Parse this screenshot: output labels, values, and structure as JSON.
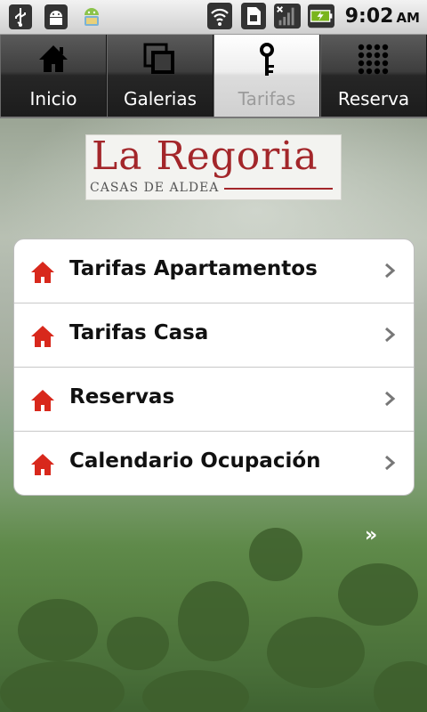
{
  "status_bar": {
    "time": "9:02",
    "ampm": "AM",
    "icons": [
      "usb-icon",
      "android-debug-icon",
      "android-app-icon",
      "wifi-icon",
      "sim-card-icon",
      "signal-icon",
      "battery-charging-icon"
    ]
  },
  "tabs": [
    {
      "label": "Inicio",
      "icon": "home-icon",
      "active": false
    },
    {
      "label": "Galerias",
      "icon": "gallery-icon",
      "active": false
    },
    {
      "label": "Tarifas",
      "icon": "key-icon",
      "active": true
    },
    {
      "label": "Reserva",
      "icon": "grid-icon",
      "active": false
    }
  ],
  "logo": {
    "title": "La Regoria",
    "subtitle": "CASAS DE ALDEA"
  },
  "menu": {
    "items": [
      {
        "label": "Tarifas Apartamentos",
        "icon": "house-icon"
      },
      {
        "label": "Tarifas Casa",
        "icon": "house-icon"
      },
      {
        "label": "Reservas",
        "icon": "house-icon"
      },
      {
        "label": "Calendario Ocupación",
        "icon": "house-icon"
      }
    ]
  },
  "next_indicator": "»",
  "colors": {
    "brand_red": "#a3262a",
    "house_icon_red": "#d8281c",
    "tab_active_text": "#9b9b9b"
  }
}
